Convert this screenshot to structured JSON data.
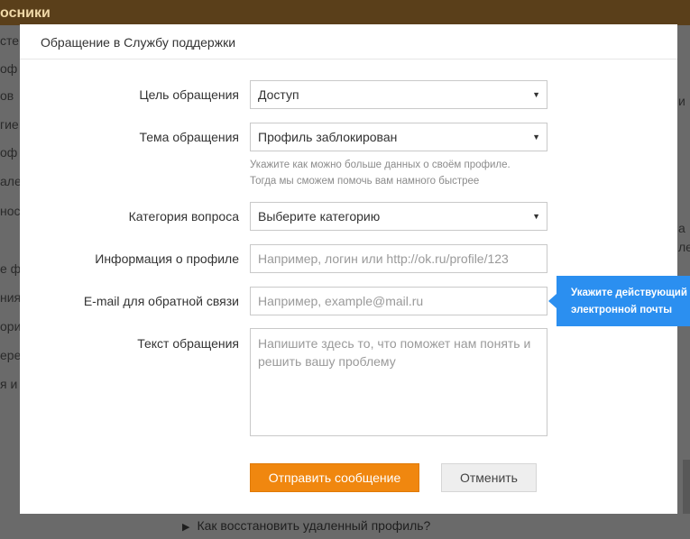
{
  "background": {
    "topbar_title": "осники",
    "left_items": [
      "сте",
      "оф",
      "ов",
      "гие",
      "оф",
      "але",
      "нос",
      "е ф",
      "ния",
      "ори",
      "ере",
      "я и"
    ],
    "right_fragments": [
      "и",
      "а",
      "ле"
    ],
    "bottom_link": "Как восстановить удаленный профиль?"
  },
  "modal": {
    "title": "Обращение в Службу поддержки",
    "fields": {
      "purpose": {
        "label": "Цель обращения",
        "value": "Доступ"
      },
      "topic": {
        "label": "Тема обращения",
        "value": "Профиль заблокирован",
        "hint_line1": "Укажите как можно больше данных о своём профиле.",
        "hint_line2": "Тогда мы сможем помочь вам намного быстрее"
      },
      "category": {
        "label": "Категория вопроса",
        "value": "Выберите категорию"
      },
      "profile_info": {
        "label": "Информация о профиле",
        "value": "",
        "placeholder": "Например, логин или http://ok.ru/profile/123"
      },
      "email": {
        "label": "E-mail для обратной связи",
        "value": "",
        "placeholder": "Например, example@mail.ru"
      },
      "message": {
        "label": "Текст обращения",
        "value": "",
        "placeholder": "Напишите здесь то, что поможет нам понять и решить вашу проблему"
      }
    },
    "submit_label": "Отправить сообщение",
    "cancel_label": "Отменить"
  },
  "tooltip": {
    "line1": "Укажите действующий а",
    "line2": "электронной почты"
  },
  "colors": {
    "primary": "#f0870f",
    "tooltip": "#2b8ff0"
  }
}
